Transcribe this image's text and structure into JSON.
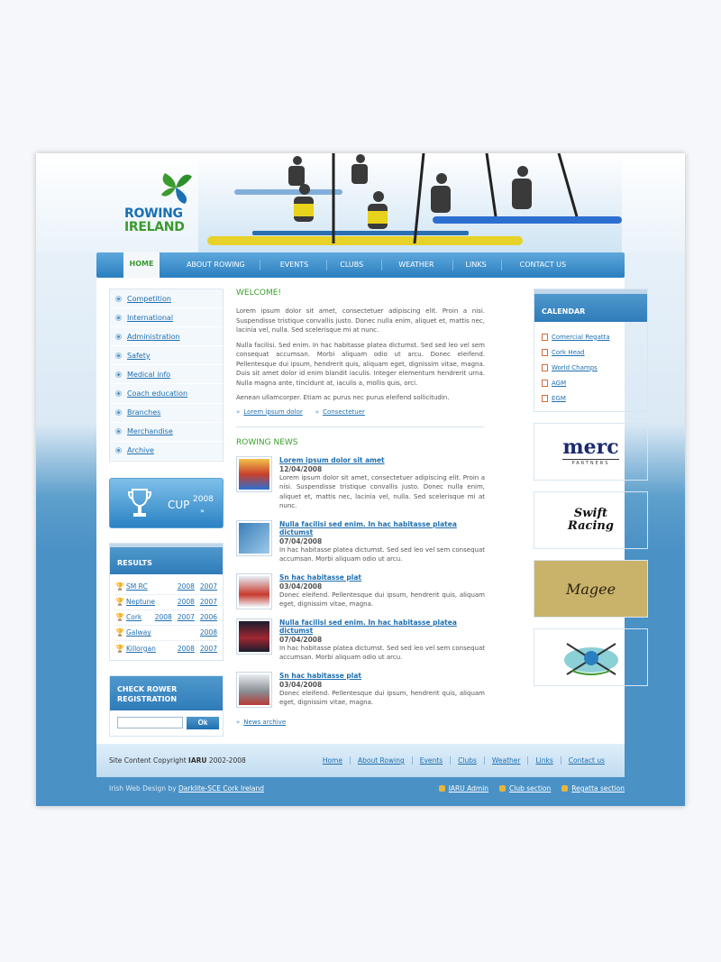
{
  "brand": {
    "line1": "ROWING",
    "line2": "IRELAND"
  },
  "nav": [
    "HOME",
    "ABOUT ROWING",
    "EVENTS",
    "CLUBS",
    "WEATHER",
    "LINKS",
    "CONTACT US"
  ],
  "sidebar": {
    "menu": [
      "Competition",
      "International",
      "Administration",
      "Safety",
      "Medical info",
      "Coach education",
      "Branches",
      "Merchandise",
      "Archive"
    ],
    "cup": {
      "label": "CUP",
      "year": "2008"
    },
    "results_title": "RESULTS",
    "results": [
      {
        "name": "SM RC",
        "years": [
          "2008",
          "2007"
        ]
      },
      {
        "name": "Neptune",
        "years": [
          "2008",
          "2007"
        ]
      },
      {
        "name": "Cork",
        "years": [
          "2008",
          "2007",
          "2006"
        ]
      },
      {
        "name": "Galway",
        "years": [
          "2008"
        ]
      },
      {
        "name": "Killorgan",
        "years": [
          "2008",
          "2007"
        ]
      }
    ],
    "check_title1": "CHECK ROWER",
    "check_title2": "REGISTRATION",
    "ok": "Ok"
  },
  "welcome": {
    "title": "WELCOME!",
    "p1": "Lorem ipsum dolor sit amet, consectetuer adipiscing elit. Proin a nisi. Suspendisse tristique convallis justo. Donec nulla enim, aliquet et, mattis nec, lacinia vel, nulla. Sed scelerisque mi at nunc.",
    "p2": "Nulla facilisi. Sed enim. In hac habitasse platea dictumst. Sed sed leo vel sem consequat accumsan. Morbi aliquam odio ut arcu. Donec eleifend. Pellentesque dui ipsum, hendrerit quis, aliquam eget, dignissim vitae, magna. Duis sit amet dolor id enim blandit iaculis. Integer elementum hendrerit urna. Nulla magna ante, tincidunt at, iaculis a, mollis quis, orci.",
    "p3": "Aenean ullamcorper. Etiam ac purus nec purus eleifend sollicitudin.",
    "link1": "Lorem ipsum dolor",
    "link2": "Consectetuer"
  },
  "news": {
    "title": "ROWING NEWS",
    "items": [
      {
        "title": "Lorem ipsum dolor sit amet",
        "date": "12/04/2008",
        "text": "Lorem ipsum dolor sit amet, consectetuer adipiscing elit. Proin a nisi. Suspendisse tristique convallis justo. Donec nulla enim, aliquet et, mattis nec, lacinia vel, nulla. Sed scelerisque mi at nunc."
      },
      {
        "title": "Nulla facilisi sed enim. In hac habitasse platea dictumst",
        "date": "07/04/2008",
        "text": "In hac habitasse platea dictumst. Sed sed leo vel sem consequat accumsan. Morbi aliquam odio ut arcu."
      },
      {
        "title": "Sn hac habitasse plat",
        "date": "03/04/2008",
        "text": "Donec eleifend. Pellentesque dui ipsum, hendrerit quis, aliquam eget, dignissim vitae, magna."
      },
      {
        "title": "Nulla facilisi sed enim. In hac habitasse platea dictumst",
        "date": "07/04/2008",
        "text": "In hac habitasse platea dictumst. Sed sed leo vel sem consequat accumsan. Morbi aliquam odio ut arcu."
      },
      {
        "title": "Sn hac habitasse plat",
        "date": "03/04/2008",
        "text": "Donec eleifend. Pellentesque dui ipsum, hendrerit quis, aliquam eget, dignissim vitae, magna."
      }
    ],
    "archive": "News archive"
  },
  "calendar": {
    "title": "CALENDAR",
    "items": [
      "Comercial Regatta",
      "Cork Head",
      "World Champs",
      "AGM",
      "EGM"
    ]
  },
  "sponsors": {
    "merc": "merc",
    "merc_sub": "PARTNERS",
    "swift1": "Swift",
    "swift2": "Racing",
    "magee": "Magee"
  },
  "footer": {
    "copyright_pre": "Site Content Copyright ",
    "copyright_org": "IARU",
    "copyright_years": " 2002-2008",
    "links": [
      "Home",
      "About Rowing",
      "Events",
      "Clubs",
      "Weather",
      "Links",
      "Contact us"
    ],
    "design_pre": "Irish Web Design by ",
    "design_link": "Darklite-SCE Cork Ireland",
    "admin": [
      "IARU Admin",
      "Club section",
      "Regatta section"
    ]
  }
}
